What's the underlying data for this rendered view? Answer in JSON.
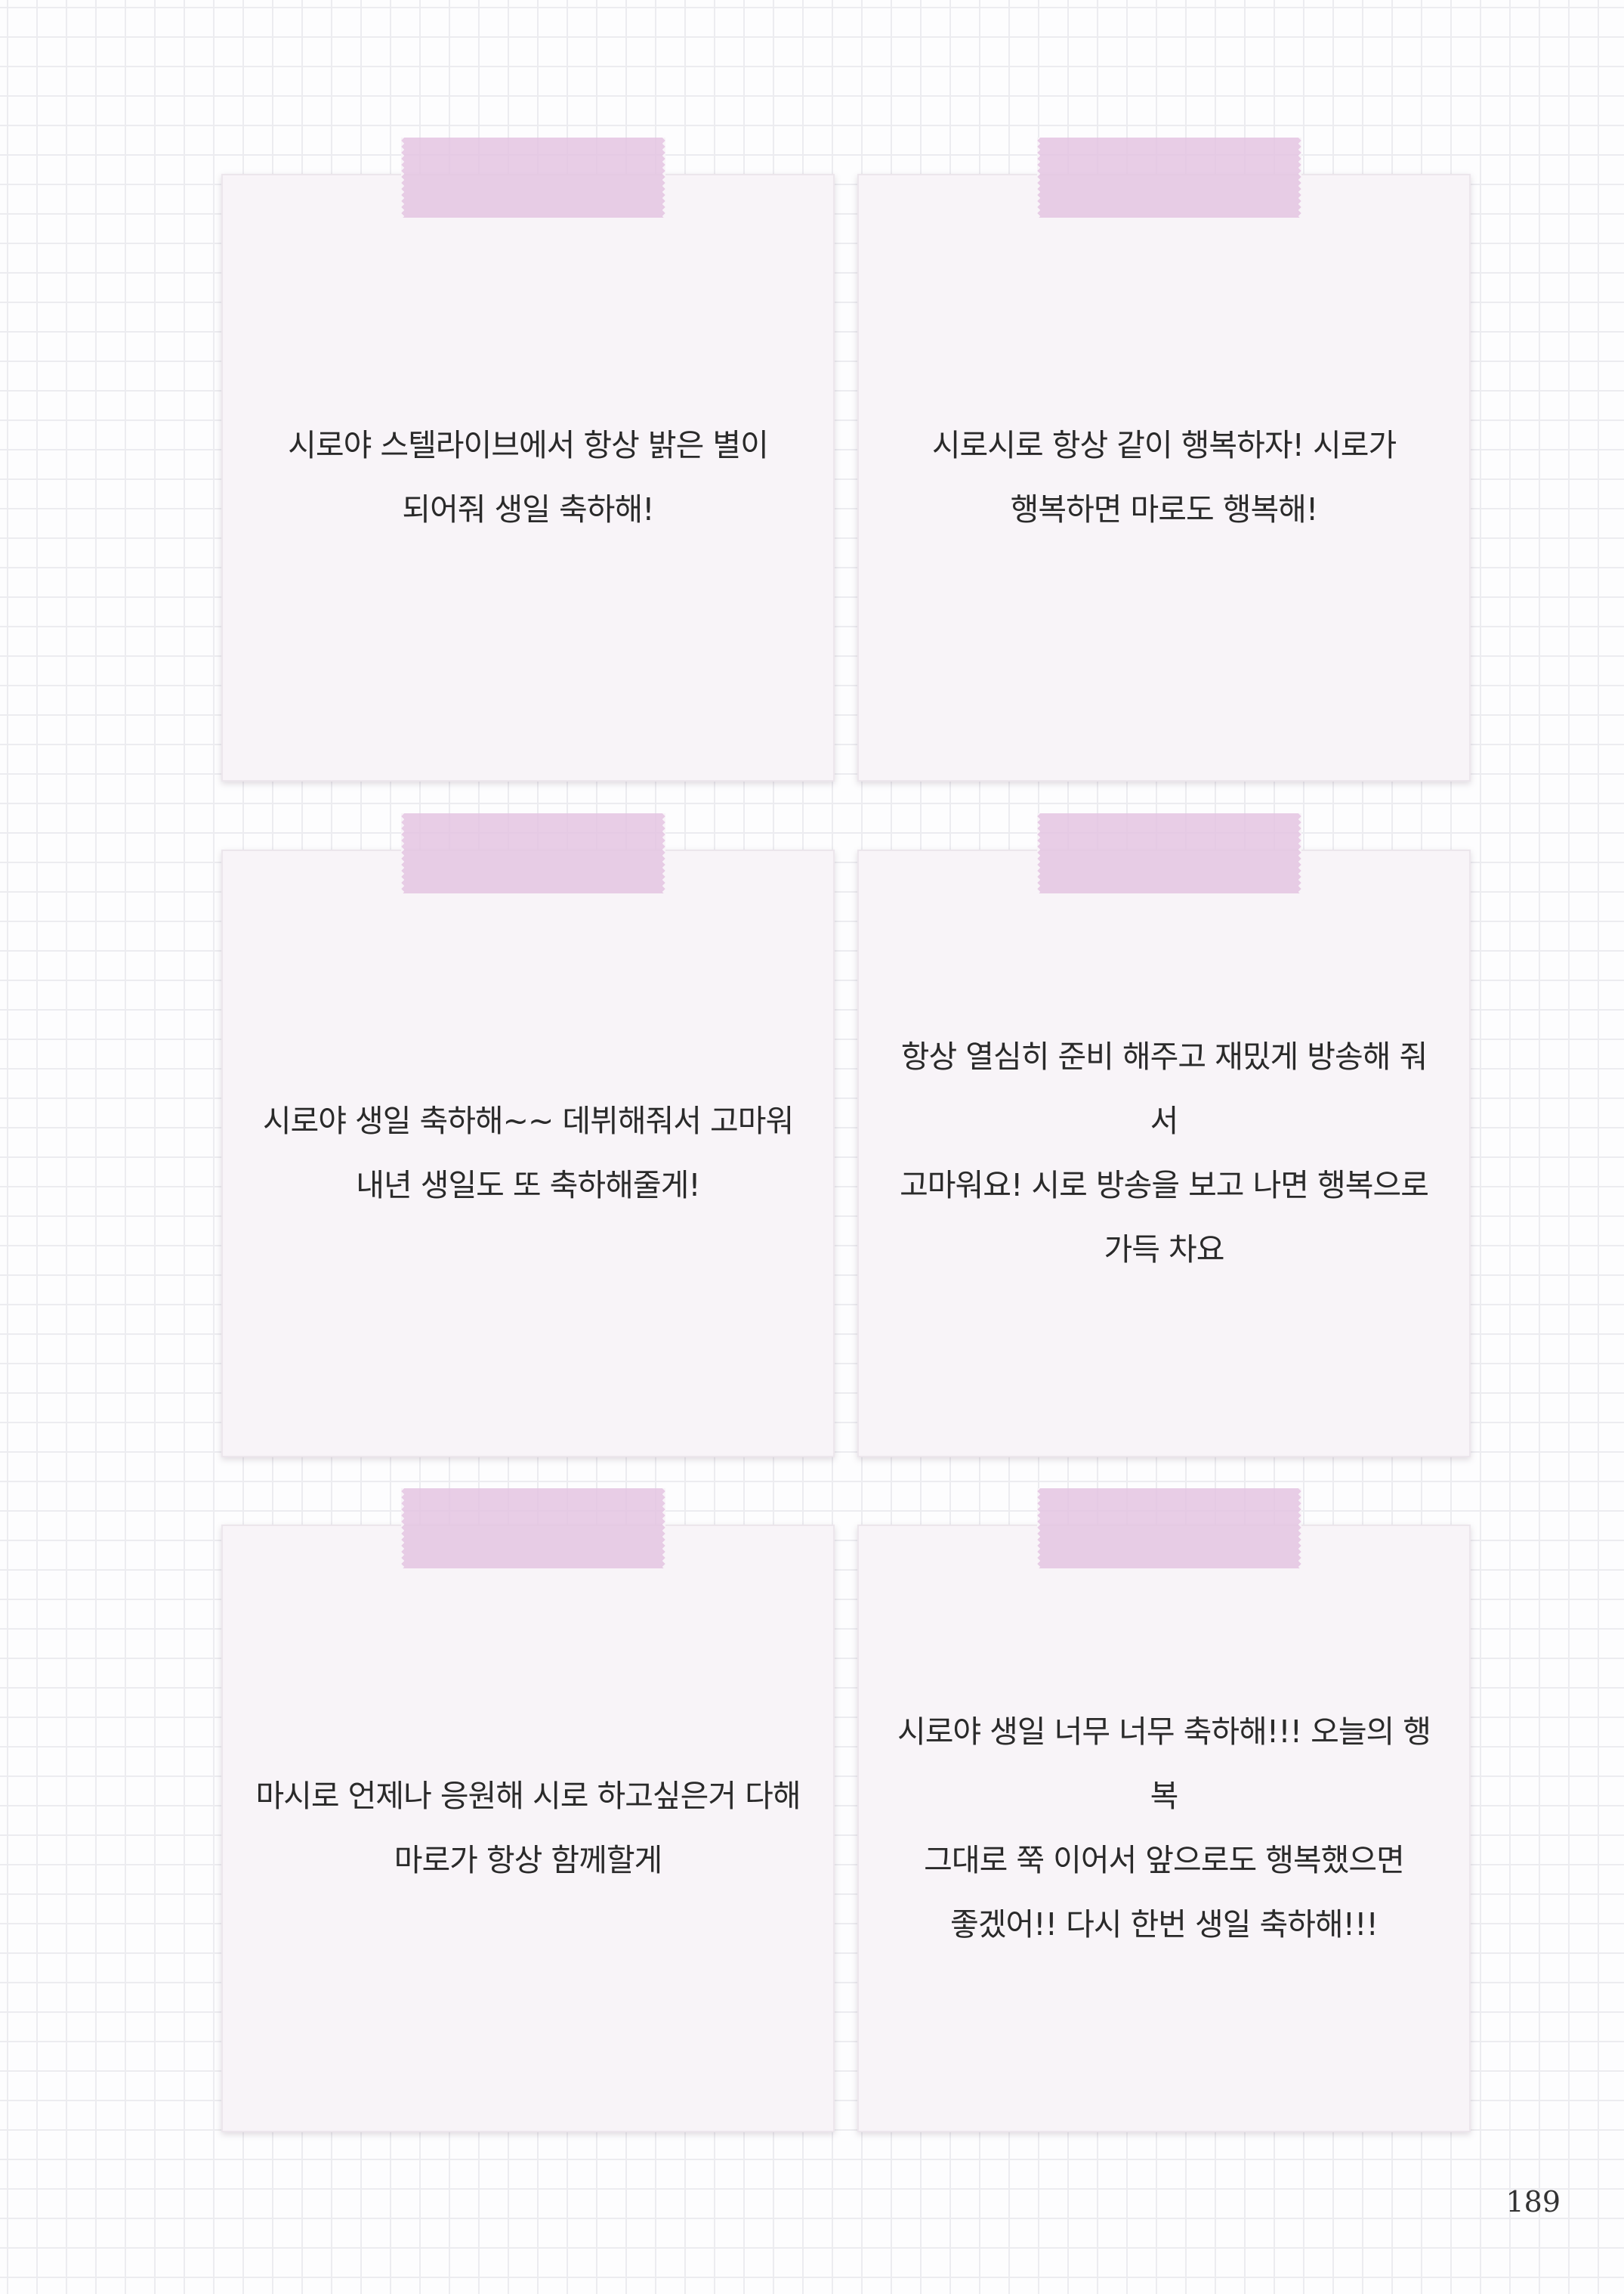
{
  "notes": [
    {
      "text": "시로야 스텔라이브에서 항상 밝은 별이\n되어줘 생일 축하해!"
    },
    {
      "text": "시로시로 항상 같이 행복하자! 시로가\n행복하면 마로도 행복해!"
    },
    {
      "text": "시로야 생일 축하해~~ 데뷔해줘서 고마워\n내년 생일도 또 축하해줄게!"
    },
    {
      "text": "항상 열심히 준비 해주고 재밌게 방송해 줘서\n고마워요! 시로 방송을 보고 나면 행복으로\n가득 차요"
    },
    {
      "text": "마시로 언제나 응원해 시로 하고싶은거 다해\n마로가 항상 함께할게"
    },
    {
      "text": "시로야 생일 너무 너무 축하해!!! 오늘의 행복\n그대로 쭉 이어서 앞으로도 행복했으면\n좋겠어!! 다시 한번 생일 축하해!!!"
    }
  ],
  "page_number": "189",
  "colors": {
    "note_background": "#f8f4f8",
    "tape": "#e4c4e2",
    "grid_line": "#ececf0"
  }
}
